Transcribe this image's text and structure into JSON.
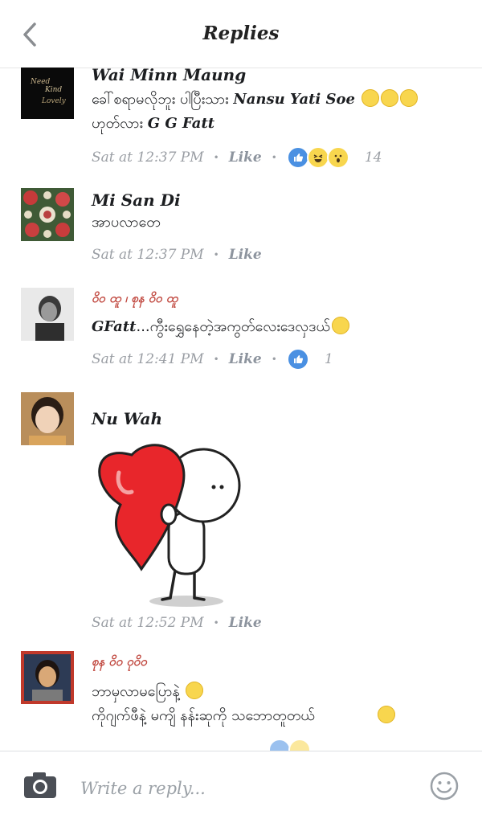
{
  "header": {
    "title": "Replies"
  },
  "comments": [
    {
      "name": "Wai Minn Maung",
      "line1": "ခေါ်စရာမလိုဘူး ပါပြီးသား",
      "tag1": "Nansu Yati Soe",
      "line2": "ဟုတ်လား",
      "tag2": "G G Fatt",
      "time": "Sat at 12:37 PM",
      "like": "Like",
      "reaction_count": "14"
    },
    {
      "name": "Mi San Di",
      "text": "အာပလာတေ",
      "time": "Sat at 12:37 PM",
      "like": "Like"
    },
    {
      "name": "ဝိဝ ထူ ၊ စုန ဝိဝ ထူ",
      "tag": "GFatt",
      "text": "...ကွီးရွှေနေတဲ့အကွတ်လေးဒေလှဒယ်",
      "time": "Sat at 12:41 PM",
      "like": "Like",
      "reaction_count": "1"
    },
    {
      "name": "Nu Wah",
      "time": "Sat at 12:52 PM",
      "like": "Like"
    },
    {
      "name": "စုန ဝိဝ ဝုဝိဝ",
      "line1": "ဘာမှလာမပြောနဲ့",
      "line2": "ကိုဂျက်ဖီနဲ့ မကျိ နန်းဆုကို သဘောတူတယ်"
    }
  ],
  "composer": {
    "placeholder": "Write a reply..."
  },
  "icons": [
    "chevron-left-icon",
    "camera-icon",
    "smiley-icon",
    "like-reaction-icon",
    "laugh-reaction-icon",
    "wow-reaction-icon"
  ],
  "colors": {
    "like_blue": "#4a90e2",
    "meta_gray": "#9a9ea4",
    "emoji_yellow": "#f8d64e",
    "heart_red": "#e8262b"
  }
}
